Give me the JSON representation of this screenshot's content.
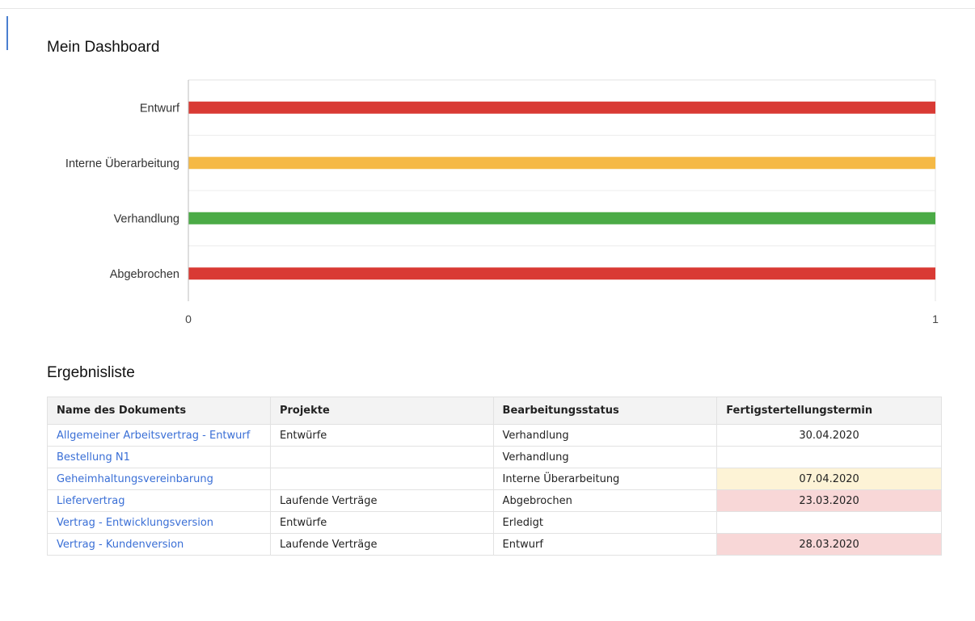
{
  "dashboard": {
    "title": "Mein Dashboard"
  },
  "chart_data": {
    "type": "bar",
    "orientation": "horizontal",
    "categories": [
      "Entwurf",
      "Interne Überarbeitung",
      "Verhandlung",
      "Abgebrochen"
    ],
    "values": [
      1,
      1,
      1,
      1
    ],
    "colors": [
      "#d93a34",
      "#f5b945",
      "#4bab46",
      "#d93a34"
    ],
    "xlim": [
      0,
      1
    ],
    "xticks": [
      "0",
      "1"
    ],
    "grid": true,
    "title": "",
    "xlabel": "",
    "ylabel": ""
  },
  "results": {
    "title": "Ergebnisliste",
    "columns": [
      "Name des Dokuments",
      "Projekte",
      "Bearbeitungsstatus",
      "Fertigstertellungstermin"
    ],
    "rows": [
      {
        "name": "Allgemeiner Arbeitsvertrag - Entwurf",
        "project": "Entwürfe",
        "status": "Verhandlung",
        "date": "30.04.2020",
        "highlight": ""
      },
      {
        "name": "Bestellung N1",
        "project": "",
        "status": "Verhandlung",
        "date": "",
        "highlight": ""
      },
      {
        "name": "Geheimhaltungsvereinbarung",
        "project": "",
        "status": "Interne Überarbeitung",
        "date": "07.04.2020",
        "highlight": "yellow"
      },
      {
        "name": "Liefervertrag",
        "project": "Laufende Verträge",
        "status": "Abgebrochen",
        "date": "23.03.2020",
        "highlight": "red"
      },
      {
        "name": "Vertrag - Entwicklungsversion",
        "project": "Entwürfe",
        "status": "Erledigt",
        "date": "",
        "highlight": ""
      },
      {
        "name": "Vertrag - Kundenversion",
        "project": "Laufende Verträge",
        "status": "Entwurf",
        "date": "28.03.2020",
        "highlight": "red"
      }
    ],
    "highlight_colors": {
      "yellow": "#fdf3d6",
      "red": "#f8d7d7"
    },
    "link_color": "#3a6fd6"
  }
}
